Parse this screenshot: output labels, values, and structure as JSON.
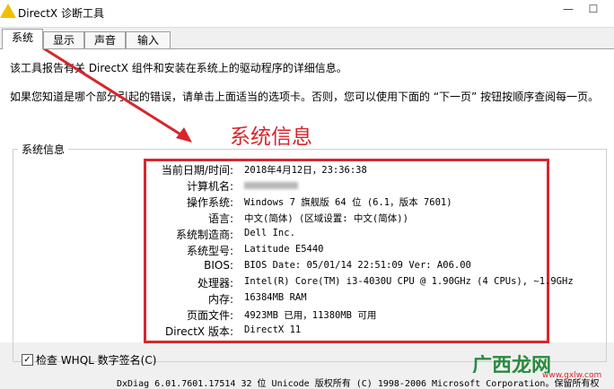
{
  "window": {
    "title": "DirectX 诊断工具",
    "min_glyph": "—",
    "max_glyph": "☐"
  },
  "tabs": [
    {
      "label": "系统"
    },
    {
      "label": "显示"
    },
    {
      "label": "声音"
    },
    {
      "label": "输入"
    }
  ],
  "intro": {
    "line1": "该工具报告有关 DirectX 组件和安装在系统上的驱动程序的详细信息。",
    "line2": "如果您知道是哪个部分引起的错误，请单击上面适当的选项卡。否则，您可以使用下面的 “下一页” 按钮按顺序查阅每一页。"
  },
  "group_label": "系统信息",
  "annotation": "系统信息",
  "system_info": [
    {
      "label": "当前日期/时间:",
      "value": "2018年4月12日，23:36:38"
    },
    {
      "label": "计算机名:",
      "value": ""
    },
    {
      "label": "操作系统:",
      "value": "Windows 7 旗舰版 64 位 (6.1，版本 7601)"
    },
    {
      "label": "语言:",
      "value": "中文(简体) (区域设置: 中文(简体))"
    },
    {
      "label": "系统制造商:",
      "value": "Dell Inc."
    },
    {
      "label": "系统型号:",
      "value": "Latitude E5440"
    },
    {
      "label": "BIOS:",
      "value": "BIOS Date: 05/01/14 22:51:09 Ver: A06.00"
    },
    {
      "label": "处理器:",
      "value": "Intel(R) Core(TM) i3-4030U CPU @ 1.90GHz (4 CPUs), ~1.9GHz"
    },
    {
      "label": "内存:",
      "value": "16384MB RAM"
    },
    {
      "label": "页面文件:",
      "value": "4923MB 已用，11380MB 可用"
    },
    {
      "label": "DirectX 版本:",
      "value": "DirectX 11"
    }
  ],
  "whql_checkbox": {
    "label": "检查 WHQL 数字签名(C)",
    "checked_glyph": "✓"
  },
  "footer": "DxDiag 6.01.7601.17514 32 位 Unicode 版权所有 (C) 1998-2006 Microsoft Corporation。保留所有权",
  "watermark": {
    "text": "广西龙网",
    "small": "www.gxlw.com",
    "color": "#2a8a3e"
  },
  "colors": {
    "accent_red": "#d7262d"
  }
}
